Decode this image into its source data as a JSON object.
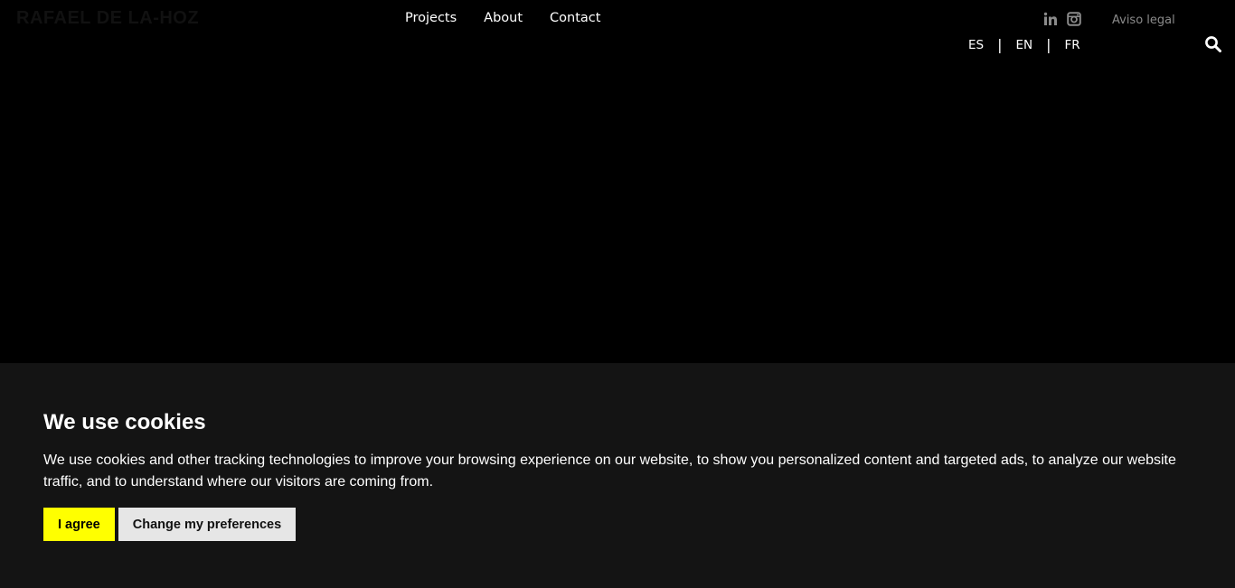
{
  "header": {
    "logo_text": "RAFAEL DE LA-HOZ",
    "nav": [
      {
        "label": "Projects"
      },
      {
        "label": "About"
      },
      {
        "label": "Contact"
      }
    ],
    "social": [
      {
        "icon": "linkedin-icon"
      },
      {
        "icon": "instagram-icon"
      }
    ],
    "legal_label": "Aviso legal",
    "languages": [
      {
        "label": "ES"
      },
      {
        "label": "EN"
      },
      {
        "label": "FR"
      }
    ],
    "language_separator": "|",
    "search_icon": "search-icon"
  },
  "cookie_banner": {
    "title": "We use cookies",
    "text": "We use cookies and other tracking technologies to improve your browsing experience on our website, to show you personalized content and targeted ads, to analyze our website traffic, and to understand where our visitors are coming from.",
    "agree_label": "I agree",
    "preferences_label": "Change my preferences"
  },
  "colors": {
    "page_background": "#000000",
    "banner_background": "#141414",
    "agree_button": "#ffff00",
    "preferences_button": "#e6e6e6",
    "icon_gray": "#8a8a8a"
  }
}
